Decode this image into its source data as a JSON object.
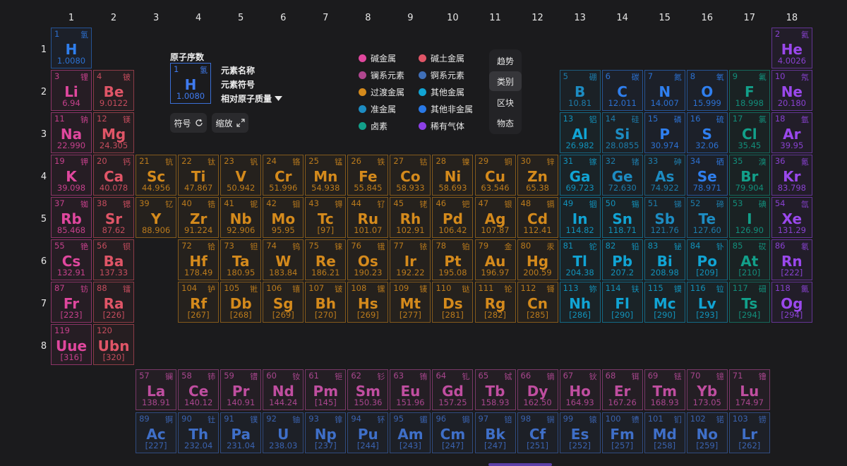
{
  "columns": [
    "1",
    "2",
    "3",
    "4",
    "5",
    "6",
    "7",
    "8",
    "9",
    "10",
    "11",
    "12",
    "13",
    "14",
    "15",
    "16",
    "17",
    "18"
  ],
  "rows": [
    "1",
    "2",
    "3",
    "4",
    "5",
    "6",
    "7",
    "8"
  ],
  "key": {
    "title": "原子序数",
    "num": "1",
    "cn": "氢",
    "symbol": "H",
    "mass": "1.0080",
    "name_label": "元素名称",
    "symbol_label": "元素符号",
    "mass_label": "相对原子质量"
  },
  "controls": {
    "symbol_btn": "符号",
    "zoom_btn": "缩放"
  },
  "legend": [
    {
      "label": "碱金属",
      "color": "#e0479e"
    },
    {
      "label": "碱土金属",
      "color": "#e05567"
    },
    {
      "label": "镧系元素",
      "color": "#b0468f"
    },
    {
      "label": "锕系元素",
      "color": "#3f6fb8"
    },
    {
      "label": "过渡金属",
      "color": "#d48a1c"
    },
    {
      "label": "其他金属",
      "color": "#11a4d4"
    },
    {
      "label": "准金属",
      "color": "#1d8cc2"
    },
    {
      "label": "其他非金属",
      "color": "#2979e6"
    },
    {
      "label": "卤素",
      "color": "#12a08a"
    },
    {
      "label": "稀有气体",
      "color": "#8c3fe6"
    }
  ],
  "view_modes": [
    "趋势",
    "类别",
    "区块",
    "物态"
  ],
  "active_view_mode": "类别",
  "category_colors": {
    "alkali": "#e0479e",
    "alkaline": "#e05567",
    "lanthanide": "#c04ea0",
    "actinide": "#3f6fc8",
    "transition": "#d48a1c",
    "post": "#11a4d4",
    "metalloid": "#1d8cc2",
    "nonmetal": "#2f7fef",
    "halogen": "#12a08a",
    "noble": "#9a48ec"
  },
  "elements": [
    {
      "n": "1",
      "cn": "氢",
      "s": "H",
      "m": "1.0080",
      "g": 1,
      "p": 1,
      "c": "nonmetal"
    },
    {
      "n": "2",
      "cn": "氦",
      "s": "He",
      "m": "4.0026",
      "g": 18,
      "p": 1,
      "c": "noble"
    },
    {
      "n": "3",
      "cn": "锂",
      "s": "Li",
      "m": "6.94",
      "g": 1,
      "p": 2,
      "c": "alkali"
    },
    {
      "n": "4",
      "cn": "铍",
      "s": "Be",
      "m": "9.0122",
      "g": 2,
      "p": 2,
      "c": "alkaline"
    },
    {
      "n": "5",
      "cn": "硼",
      "s": "B",
      "m": "10.81",
      "g": 13,
      "p": 2,
      "c": "metalloid"
    },
    {
      "n": "6",
      "cn": "碳",
      "s": "C",
      "m": "12.011",
      "g": 14,
      "p": 2,
      "c": "nonmetal"
    },
    {
      "n": "7",
      "cn": "氮",
      "s": "N",
      "m": "14.007",
      "g": 15,
      "p": 2,
      "c": "nonmetal"
    },
    {
      "n": "8",
      "cn": "氧",
      "s": "O",
      "m": "15.999",
      "g": 16,
      "p": 2,
      "c": "nonmetal"
    },
    {
      "n": "9",
      "cn": "氟",
      "s": "F",
      "m": "18.998",
      "g": 17,
      "p": 2,
      "c": "halogen"
    },
    {
      "n": "10",
      "cn": "氖",
      "s": "Ne",
      "m": "20.180",
      "g": 18,
      "p": 2,
      "c": "noble"
    },
    {
      "n": "11",
      "cn": "钠",
      "s": "Na",
      "m": "22.990",
      "g": 1,
      "p": 3,
      "c": "alkali"
    },
    {
      "n": "12",
      "cn": "镁",
      "s": "Mg",
      "m": "24.305",
      "g": 2,
      "p": 3,
      "c": "alkaline"
    },
    {
      "n": "13",
      "cn": "铝",
      "s": "Al",
      "m": "26.982",
      "g": 13,
      "p": 3,
      "c": "post"
    },
    {
      "n": "14",
      "cn": "硅",
      "s": "Si",
      "m": "28.0855",
      "g": 14,
      "p": 3,
      "c": "metalloid"
    },
    {
      "n": "15",
      "cn": "磷",
      "s": "P",
      "m": "30.974",
      "g": 15,
      "p": 3,
      "c": "nonmetal"
    },
    {
      "n": "16",
      "cn": "硫",
      "s": "S",
      "m": "32.06",
      "g": 16,
      "p": 3,
      "c": "nonmetal"
    },
    {
      "n": "17",
      "cn": "氯",
      "s": "Cl",
      "m": "35.45",
      "g": 17,
      "p": 3,
      "c": "halogen"
    },
    {
      "n": "18",
      "cn": "氩",
      "s": "Ar",
      "m": "39.95",
      "g": 18,
      "p": 3,
      "c": "noble"
    },
    {
      "n": "19",
      "cn": "钾",
      "s": "K",
      "m": "39.098",
      "g": 1,
      "p": 4,
      "c": "alkali"
    },
    {
      "n": "20",
      "cn": "钙",
      "s": "Ca",
      "m": "40.078",
      "g": 2,
      "p": 4,
      "c": "alkaline"
    },
    {
      "n": "21",
      "cn": "钪",
      "s": "Sc",
      "m": "44.956",
      "g": 3,
      "p": 4,
      "c": "transition"
    },
    {
      "n": "22",
      "cn": "钛",
      "s": "Ti",
      "m": "47.867",
      "g": 4,
      "p": 4,
      "c": "transition"
    },
    {
      "n": "23",
      "cn": "钒",
      "s": "V",
      "m": "50.942",
      "g": 5,
      "p": 4,
      "c": "transition"
    },
    {
      "n": "24",
      "cn": "铬",
      "s": "Cr",
      "m": "51.996",
      "g": 6,
      "p": 4,
      "c": "transition"
    },
    {
      "n": "25",
      "cn": "锰",
      "s": "Mn",
      "m": "54.938",
      "g": 7,
      "p": 4,
      "c": "transition"
    },
    {
      "n": "26",
      "cn": "铁",
      "s": "Fe",
      "m": "55.845",
      "g": 8,
      "p": 4,
      "c": "transition"
    },
    {
      "n": "27",
      "cn": "钴",
      "s": "Co",
      "m": "58.933",
      "g": 9,
      "p": 4,
      "c": "transition"
    },
    {
      "n": "28",
      "cn": "镍",
      "s": "Ni",
      "m": "58.693",
      "g": 10,
      "p": 4,
      "c": "transition"
    },
    {
      "n": "29",
      "cn": "铜",
      "s": "Cu",
      "m": "63.546",
      "g": 11,
      "p": 4,
      "c": "transition"
    },
    {
      "n": "30",
      "cn": "锌",
      "s": "Zn",
      "m": "65.38",
      "g": 12,
      "p": 4,
      "c": "transition"
    },
    {
      "n": "31",
      "cn": "镓",
      "s": "Ga",
      "m": "69.723",
      "g": 13,
      "p": 4,
      "c": "post"
    },
    {
      "n": "32",
      "cn": "锗",
      "s": "Ge",
      "m": "72.630",
      "g": 14,
      "p": 4,
      "c": "metalloid"
    },
    {
      "n": "33",
      "cn": "砷",
      "s": "As",
      "m": "74.922",
      "g": 15,
      "p": 4,
      "c": "metalloid"
    },
    {
      "n": "34",
      "cn": "硒",
      "s": "Se",
      "m": "78.971",
      "g": 16,
      "p": 4,
      "c": "nonmetal"
    },
    {
      "n": "35",
      "cn": "溴",
      "s": "Br",
      "m": "79.904",
      "g": 17,
      "p": 4,
      "c": "halogen"
    },
    {
      "n": "36",
      "cn": "氪",
      "s": "Kr",
      "m": "83.798",
      "g": 18,
      "p": 4,
      "c": "noble"
    },
    {
      "n": "37",
      "cn": "铷",
      "s": "Rb",
      "m": "85.468",
      "g": 1,
      "p": 5,
      "c": "alkali"
    },
    {
      "n": "38",
      "cn": "锶",
      "s": "Sr",
      "m": "87.62",
      "g": 2,
      "p": 5,
      "c": "alkaline"
    },
    {
      "n": "39",
      "cn": "钇",
      "s": "Y",
      "m": "88.906",
      "g": 3,
      "p": 5,
      "c": "transition"
    },
    {
      "n": "40",
      "cn": "锆",
      "s": "Zr",
      "m": "91.224",
      "g": 4,
      "p": 5,
      "c": "transition"
    },
    {
      "n": "41",
      "cn": "铌",
      "s": "Nb",
      "m": "92.906",
      "g": 5,
      "p": 5,
      "c": "transition"
    },
    {
      "n": "42",
      "cn": "钼",
      "s": "Mo",
      "m": "95.95",
      "g": 6,
      "p": 5,
      "c": "transition"
    },
    {
      "n": "43",
      "cn": "锝",
      "s": "Tc",
      "m": "[97]",
      "g": 7,
      "p": 5,
      "c": "transition"
    },
    {
      "n": "44",
      "cn": "钌",
      "s": "Ru",
      "m": "101.07",
      "g": 8,
      "p": 5,
      "c": "transition"
    },
    {
      "n": "45",
      "cn": "铑",
      "s": "Rh",
      "m": "102.91",
      "g": 9,
      "p": 5,
      "c": "transition"
    },
    {
      "n": "46",
      "cn": "钯",
      "s": "Pd",
      "m": "106.42",
      "g": 10,
      "p": 5,
      "c": "transition"
    },
    {
      "n": "47",
      "cn": "银",
      "s": "Ag",
      "m": "107.87",
      "g": 11,
      "p": 5,
      "c": "transition"
    },
    {
      "n": "48",
      "cn": "镉",
      "s": "Cd",
      "m": "112.41",
      "g": 12,
      "p": 5,
      "c": "transition"
    },
    {
      "n": "49",
      "cn": "铟",
      "s": "In",
      "m": "114.82",
      "g": 13,
      "p": 5,
      "c": "post"
    },
    {
      "n": "50",
      "cn": "锡",
      "s": "Sn",
      "m": "118.71",
      "g": 14,
      "p": 5,
      "c": "post"
    },
    {
      "n": "51",
      "cn": "锑",
      "s": "Sb",
      "m": "121.76",
      "g": 15,
      "p": 5,
      "c": "metalloid"
    },
    {
      "n": "52",
      "cn": "碲",
      "s": "Te",
      "m": "127.60",
      "g": 16,
      "p": 5,
      "c": "metalloid"
    },
    {
      "n": "53",
      "cn": "碘",
      "s": "I",
      "m": "126.90",
      "g": 17,
      "p": 5,
      "c": "halogen"
    },
    {
      "n": "54",
      "cn": "氙",
      "s": "Xe",
      "m": "131.29",
      "g": 18,
      "p": 5,
      "c": "noble"
    },
    {
      "n": "55",
      "cn": "铯",
      "s": "Cs",
      "m": "132.91",
      "g": 1,
      "p": 6,
      "c": "alkali"
    },
    {
      "n": "56",
      "cn": "钡",
      "s": "Ba",
      "m": "137.33",
      "g": 2,
      "p": 6,
      "c": "alkaline"
    },
    {
      "n": "72",
      "cn": "铪",
      "s": "Hf",
      "m": "178.49",
      "g": 4,
      "p": 6,
      "c": "transition"
    },
    {
      "n": "73",
      "cn": "钽",
      "s": "Ta",
      "m": "180.95",
      "g": 5,
      "p": 6,
      "c": "transition"
    },
    {
      "n": "74",
      "cn": "钨",
      "s": "W",
      "m": "183.84",
      "g": 6,
      "p": 6,
      "c": "transition"
    },
    {
      "n": "75",
      "cn": "铼",
      "s": "Re",
      "m": "186.21",
      "g": 7,
      "p": 6,
      "c": "transition"
    },
    {
      "n": "76",
      "cn": "锇",
      "s": "Os",
      "m": "190.23",
      "g": 8,
      "p": 6,
      "c": "transition"
    },
    {
      "n": "77",
      "cn": "铱",
      "s": "Ir",
      "m": "192.22",
      "g": 9,
      "p": 6,
      "c": "transition"
    },
    {
      "n": "78",
      "cn": "铂",
      "s": "Pt",
      "m": "195.08",
      "g": 10,
      "p": 6,
      "c": "transition"
    },
    {
      "n": "79",
      "cn": "金",
      "s": "Au",
      "m": "196.97",
      "g": 11,
      "p": 6,
      "c": "transition"
    },
    {
      "n": "80",
      "cn": "汞",
      "s": "Hg",
      "m": "200.59",
      "g": 12,
      "p": 6,
      "c": "transition"
    },
    {
      "n": "81",
      "cn": "铊",
      "s": "Tl",
      "m": "204.38",
      "g": 13,
      "p": 6,
      "c": "post"
    },
    {
      "n": "82",
      "cn": "铅",
      "s": "Pb",
      "m": "207.2",
      "g": 14,
      "p": 6,
      "c": "post"
    },
    {
      "n": "83",
      "cn": "铋",
      "s": "Bi",
      "m": "208.98",
      "g": 15,
      "p": 6,
      "c": "post"
    },
    {
      "n": "84",
      "cn": "钋",
      "s": "Po",
      "m": "[209]",
      "g": 16,
      "p": 6,
      "c": "post"
    },
    {
      "n": "85",
      "cn": "砹",
      "s": "At",
      "m": "[210]",
      "g": 17,
      "p": 6,
      "c": "halogen"
    },
    {
      "n": "86",
      "cn": "氡",
      "s": "Rn",
      "m": "[222]",
      "g": 18,
      "p": 6,
      "c": "noble"
    },
    {
      "n": "87",
      "cn": "钫",
      "s": "Fr",
      "m": "[223]",
      "g": 1,
      "p": 7,
      "c": "alkali"
    },
    {
      "n": "88",
      "cn": "镭",
      "s": "Ra",
      "m": "[226]",
      "g": 2,
      "p": 7,
      "c": "alkaline"
    },
    {
      "n": "104",
      "cn": "𬬻",
      "s": "Rf",
      "m": "[267]",
      "g": 4,
      "p": 7,
      "c": "transition"
    },
    {
      "n": "105",
      "cn": "𬭊",
      "s": "Db",
      "m": "[268]",
      "g": 5,
      "p": 7,
      "c": "transition"
    },
    {
      "n": "106",
      "cn": "𬭳",
      "s": "Sg",
      "m": "[269]",
      "g": 6,
      "p": 7,
      "c": "transition"
    },
    {
      "n": "107",
      "cn": "𬭛",
      "s": "Bh",
      "m": "[270]",
      "g": 7,
      "p": 7,
      "c": "transition"
    },
    {
      "n": "108",
      "cn": "𬭶",
      "s": "Hs",
      "m": "[269]",
      "g": 8,
      "p": 7,
      "c": "transition"
    },
    {
      "n": "109",
      "cn": "鿏",
      "s": "Mt",
      "m": "[277]",
      "g": 9,
      "p": 7,
      "c": "transition"
    },
    {
      "n": "110",
      "cn": "𫟼",
      "s": "Ds",
      "m": "[281]",
      "g": 10,
      "p": 7,
      "c": "transition"
    },
    {
      "n": "111",
      "cn": "𬬭",
      "s": "Rg",
      "m": "[282]",
      "g": 11,
      "p": 7,
      "c": "transition"
    },
    {
      "n": "112",
      "cn": "鿔",
      "s": "Cn",
      "m": "[285]",
      "g": 12,
      "p": 7,
      "c": "transition"
    },
    {
      "n": "113",
      "cn": "鿭",
      "s": "Nh",
      "m": "[286]",
      "g": 13,
      "p": 7,
      "c": "post"
    },
    {
      "n": "114",
      "cn": "𫓧",
      "s": "Fl",
      "m": "[290]",
      "g": 14,
      "p": 7,
      "c": "post"
    },
    {
      "n": "115",
      "cn": "镆",
      "s": "Mc",
      "m": "[290]",
      "g": 15,
      "p": 7,
      "c": "post"
    },
    {
      "n": "116",
      "cn": "𫟷",
      "s": "Lv",
      "m": "[293]",
      "g": 16,
      "p": 7,
      "c": "post"
    },
    {
      "n": "117",
      "cn": "鿬",
      "s": "Ts",
      "m": "[294]",
      "g": 17,
      "p": 7,
      "c": "halogen"
    },
    {
      "n": "118",
      "cn": "鿫",
      "s": "Og",
      "m": "[294]",
      "g": 18,
      "p": 7,
      "c": "noble"
    },
    {
      "n": "119",
      "cn": "",
      "s": "Uue",
      "m": "[316]",
      "g": 1,
      "p": 8,
      "c": "alkali"
    },
    {
      "n": "120",
      "cn": "",
      "s": "Ubn",
      "m": "[320]",
      "g": 2,
      "p": 8,
      "c": "alkaline"
    }
  ],
  "lanthanides": [
    {
      "n": "57",
      "cn": "镧",
      "s": "La",
      "m": "138.91"
    },
    {
      "n": "58",
      "cn": "铈",
      "s": "Ce",
      "m": "140.12"
    },
    {
      "n": "59",
      "cn": "镨",
      "s": "Pr",
      "m": "140.91"
    },
    {
      "n": "60",
      "cn": "钕",
      "s": "Nd",
      "m": "144.24"
    },
    {
      "n": "61",
      "cn": "钷",
      "s": "Pm",
      "m": "[145]"
    },
    {
      "n": "62",
      "cn": "钐",
      "s": "Sm",
      "m": "150.36"
    },
    {
      "n": "63",
      "cn": "铕",
      "s": "Eu",
      "m": "151.96"
    },
    {
      "n": "64",
      "cn": "钆",
      "s": "Gd",
      "m": "157.25"
    },
    {
      "n": "65",
      "cn": "铽",
      "s": "Tb",
      "m": "158.93"
    },
    {
      "n": "66",
      "cn": "镝",
      "s": "Dy",
      "m": "162.50"
    },
    {
      "n": "67",
      "cn": "钬",
      "s": "Ho",
      "m": "164.93"
    },
    {
      "n": "68",
      "cn": "铒",
      "s": "Er",
      "m": "167.26"
    },
    {
      "n": "69",
      "cn": "铥",
      "s": "Tm",
      "m": "168.93"
    },
    {
      "n": "70",
      "cn": "镱",
      "s": "Yb",
      "m": "173.05"
    },
    {
      "n": "71",
      "cn": "镥",
      "s": "Lu",
      "m": "174.97"
    }
  ],
  "actinides": [
    {
      "n": "89",
      "cn": "锕",
      "s": "Ac",
      "m": "[227]"
    },
    {
      "n": "90",
      "cn": "钍",
      "s": "Th",
      "m": "232.04"
    },
    {
      "n": "91",
      "cn": "镤",
      "s": "Pa",
      "m": "231.04"
    },
    {
      "n": "92",
      "cn": "铀",
      "s": "U",
      "m": "238.03"
    },
    {
      "n": "93",
      "cn": "镎",
      "s": "Np",
      "m": "[237]"
    },
    {
      "n": "94",
      "cn": "钚",
      "s": "Pu",
      "m": "[244]"
    },
    {
      "n": "95",
      "cn": "镅",
      "s": "Am",
      "m": "[243]"
    },
    {
      "n": "96",
      "cn": "锔",
      "s": "Cm",
      "m": "[247]"
    },
    {
      "n": "97",
      "cn": "锫",
      "s": "Bk",
      "m": "[247]"
    },
    {
      "n": "98",
      "cn": "锎",
      "s": "Cf",
      "m": "[251]"
    },
    {
      "n": "99",
      "cn": "锿",
      "s": "Es",
      "m": "[252]"
    },
    {
      "n": "100",
      "cn": "镄",
      "s": "Fm",
      "m": "[257]"
    },
    {
      "n": "101",
      "cn": "钔",
      "s": "Md",
      "m": "[258]"
    },
    {
      "n": "102",
      "cn": "锘",
      "s": "No",
      "m": "[259]"
    },
    {
      "n": "103",
      "cn": "铹",
      "s": "Lr",
      "m": "[262]"
    }
  ]
}
